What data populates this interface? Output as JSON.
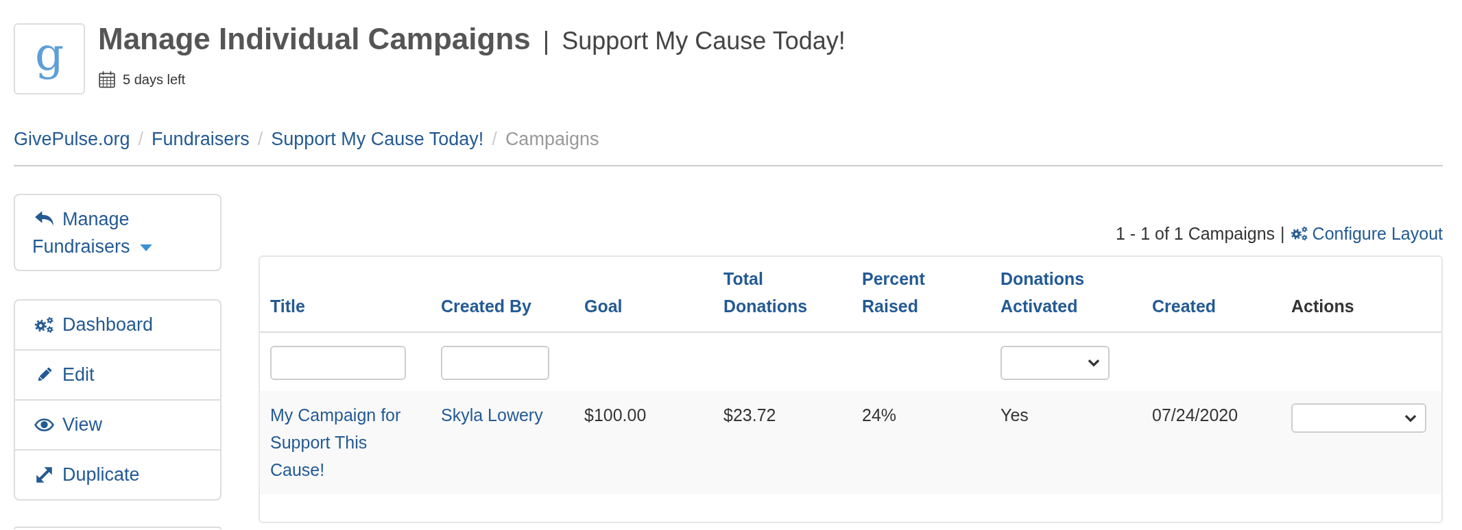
{
  "logo": {
    "letter": "g"
  },
  "header": {
    "title": "Manage Individual Campaigns",
    "separator": "|",
    "subtitle": "Support My Cause Today!",
    "deadline": "5 days left"
  },
  "breadcrumb": {
    "separator": "/",
    "items": [
      {
        "label": "GivePulse.org",
        "current": false
      },
      {
        "label": "Fundraisers",
        "current": false
      },
      {
        "label": "Support My Cause Today!",
        "current": false
      },
      {
        "label": "Campaigns",
        "current": true
      }
    ]
  },
  "sidebar": {
    "menu_button": {
      "label": "Manage Fundraisers"
    },
    "items": [
      {
        "label": "Dashboard"
      },
      {
        "label": "Edit"
      },
      {
        "label": "View"
      },
      {
        "label": "Duplicate"
      }
    ]
  },
  "results": {
    "summary": "1 - 1 of 1 Campaigns",
    "separator": "|",
    "configure_link": "Configure Layout"
  },
  "table": {
    "columns": [
      {
        "label": "Title",
        "sortable": true,
        "filter": {
          "kind": "text"
        }
      },
      {
        "label": "Created By",
        "sortable": true,
        "filter": {
          "kind": "text"
        }
      },
      {
        "label": "Goal",
        "sortable": true
      },
      {
        "label": "Total Donations",
        "sortable": true
      },
      {
        "label": "Percent Raised",
        "sortable": true
      },
      {
        "label": "Donations Activated",
        "sortable": true,
        "filter": {
          "kind": "select"
        }
      },
      {
        "label": "Created",
        "sortable": true
      },
      {
        "label": "Actions",
        "sortable": false
      }
    ],
    "rows": [
      {
        "cells": [
          {
            "kind": "link",
            "text": "My Campaign for Support This Cause!"
          },
          {
            "kind": "link",
            "text": "Skyla Lowery"
          },
          {
            "kind": "text",
            "text": "$100.00"
          },
          {
            "kind": "text",
            "text": "$23.72"
          },
          {
            "kind": "text",
            "text": "24%"
          },
          {
            "kind": "text",
            "text": "Yes"
          },
          {
            "kind": "text",
            "text": "07/24/2020"
          },
          {
            "kind": "select"
          }
        ]
      }
    ]
  }
}
